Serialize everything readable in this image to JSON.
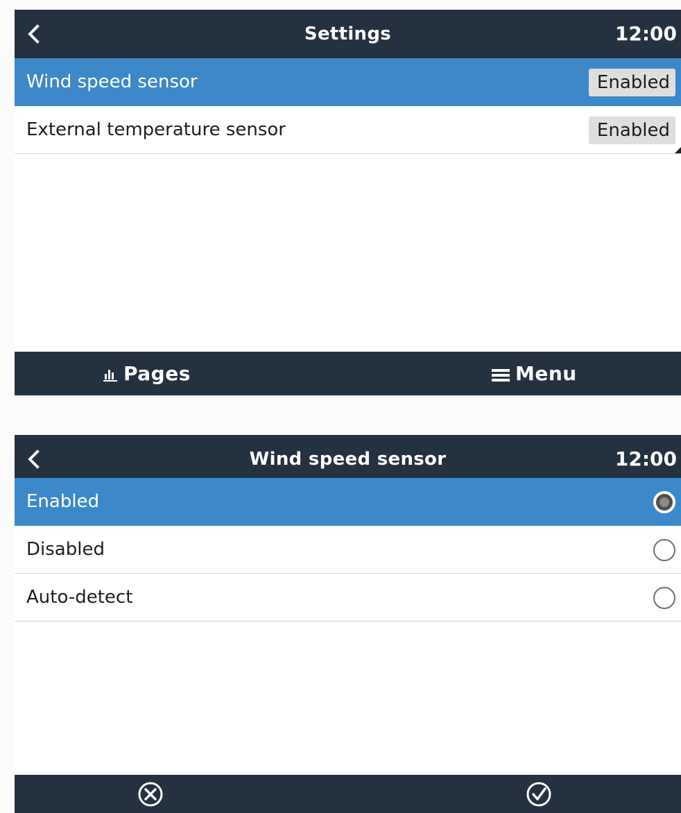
{
  "colors": {
    "header_bg": "#243140",
    "selected_row_bg": "#3c88c8",
    "value_box_bg": "#dedede",
    "text": "#1d1d1d",
    "page_bg": "#ffffff"
  },
  "settings_screen": {
    "back_icon": "chevron-left-icon",
    "title": "Settings",
    "clock": "12:00",
    "items": [
      {
        "label": "Wind speed sensor",
        "value": "Enabled",
        "selected": true
      },
      {
        "label": "External temperature sensor",
        "value": "Enabled",
        "selected": false
      }
    ],
    "footer": {
      "pages_icon": "bar-chart-icon",
      "pages_label": "Pages",
      "menu_icon": "hamburger-menu-icon",
      "menu_label": "Menu"
    }
  },
  "option_screen": {
    "back_icon": "chevron-left-icon",
    "title": "Wind speed sensor",
    "clock": "12:00",
    "options": [
      {
        "label": "Enabled",
        "checked": true,
        "selected": true
      },
      {
        "label": "Disabled",
        "checked": false,
        "selected": false
      },
      {
        "label": "Auto-detect",
        "checked": false,
        "selected": false
      }
    ],
    "footer": {
      "cancel_icon": "cancel-circle-icon",
      "confirm_icon": "check-circle-icon"
    }
  }
}
